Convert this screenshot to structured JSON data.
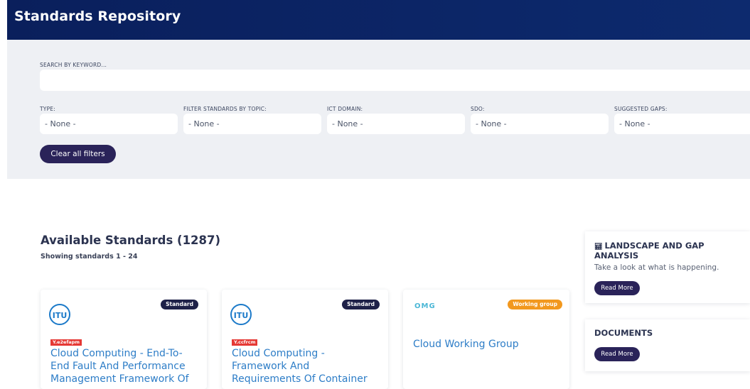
{
  "header": {
    "title": "Standards Repository"
  },
  "search": {
    "label": "SEARCH BY KEYWORD...",
    "value": ""
  },
  "filters": [
    {
      "label": "TYPE:",
      "value": "- None -"
    },
    {
      "label": "FILTER STANDARDS BY TOPIC:",
      "value": "- None -"
    },
    {
      "label": "ICT DOMAIN:",
      "value": "- None -"
    },
    {
      "label": "SDO:",
      "value": "- None -"
    },
    {
      "label": "SUGGESTED GAPS:",
      "value": "- None -"
    }
  ],
  "clear_filters_label": "Clear all filters",
  "results": {
    "title": "Available Standards (1287)",
    "showing": "Showing standards 1 - 24"
  },
  "cards": [
    {
      "badge": "Standard",
      "code": "Y.e2efapm",
      "title": "Cloud Computing - End-To-End Fault And Performance Management Framework Of",
      "logo": "ITU"
    },
    {
      "badge": "Standard",
      "code": "Y.ccfrcm",
      "title": "Cloud Computing - Framework And Requirements Of Container",
      "logo": "ITU"
    },
    {
      "badge": "Working group",
      "title": "Cloud Working Group",
      "logo": "OMG"
    }
  ],
  "sidebar": {
    "landscape": {
      "title": "LANDSCAPE AND GAP ANALYSIS",
      "text": "Take a look at what is happening.",
      "button": "Read More",
      "icon": "bar-chart-icon"
    },
    "documents": {
      "title": "DOCUMENTS",
      "button": "Read More"
    }
  },
  "colors": {
    "header": "#0a1f5c",
    "button": "#2a2359",
    "link": "#2d7dc7",
    "working_group": "#f2981e",
    "code_tag": "#e53935"
  }
}
